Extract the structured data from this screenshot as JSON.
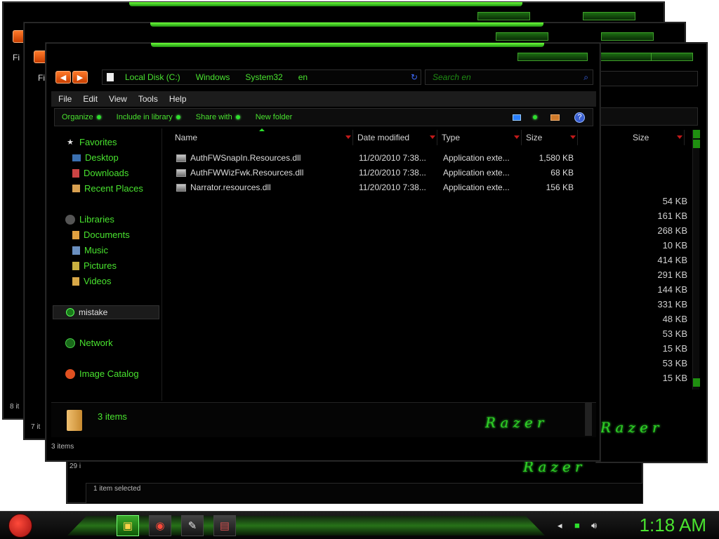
{
  "back_windows": [
    {
      "menu_stub": "Fi",
      "status": "8 it"
    },
    {
      "menu_stub": "Fi",
      "status": "7 it"
    },
    {
      "menu_stub": "",
      "status": "29 i"
    }
  ],
  "back_window_status": "1 item selected",
  "bg_column_header": "Size",
  "bg_sizes": [
    "54 KB",
    "161 KB",
    "268 KB",
    "10 KB",
    "414 KB",
    "291 KB",
    "144 KB",
    "331 KB",
    "48 KB",
    "53 KB",
    "15 KB",
    "53 KB",
    "15 KB"
  ],
  "nav": {
    "back_label": "◀",
    "forward_label": "▶"
  },
  "address": {
    "segments": [
      "Local Disk (C:)",
      "Windows",
      "System32",
      "en"
    ]
  },
  "search": {
    "placeholder": "Search en"
  },
  "menu": [
    "File",
    "Edit",
    "View",
    "Tools",
    "Help"
  ],
  "toolbar": {
    "organize": "Organize",
    "include": "Include in library",
    "share": "Share with",
    "new_folder": "New folder"
  },
  "sidebar": {
    "favorites": {
      "label": "Favorites",
      "items": [
        "Desktop",
        "Downloads",
        "Recent Places"
      ]
    },
    "libraries": {
      "label": "Libraries",
      "items": [
        "Documents",
        "Music",
        "Pictures",
        "Videos"
      ]
    },
    "homegroup": "mistake",
    "network": "Network",
    "image_catalog": "Image Catalog"
  },
  "columns": [
    "Name",
    "Date modified",
    "Type",
    "Size"
  ],
  "files": [
    {
      "name": "AuthFWSnapIn.Resources.dll",
      "date": "11/20/2010 7:38...",
      "type": "Application exte...",
      "size": "1,580 KB"
    },
    {
      "name": "AuthFWWizFwk.Resources.dll",
      "date": "11/20/2010 7:38...",
      "type": "Application exte...",
      "size": "68 KB"
    },
    {
      "name": "Narrator.resources.dll",
      "date": "11/20/2010 7:38...",
      "type": "Application exte...",
      "size": "156 KB"
    }
  ],
  "details": {
    "item_count": "3 items"
  },
  "status": "3 items",
  "brand": "Razer",
  "taskbar": {
    "clock": "1:18 AM"
  },
  "colors": {
    "accent_green": "#49e32f",
    "brand_orange": "#ff7a2a"
  }
}
